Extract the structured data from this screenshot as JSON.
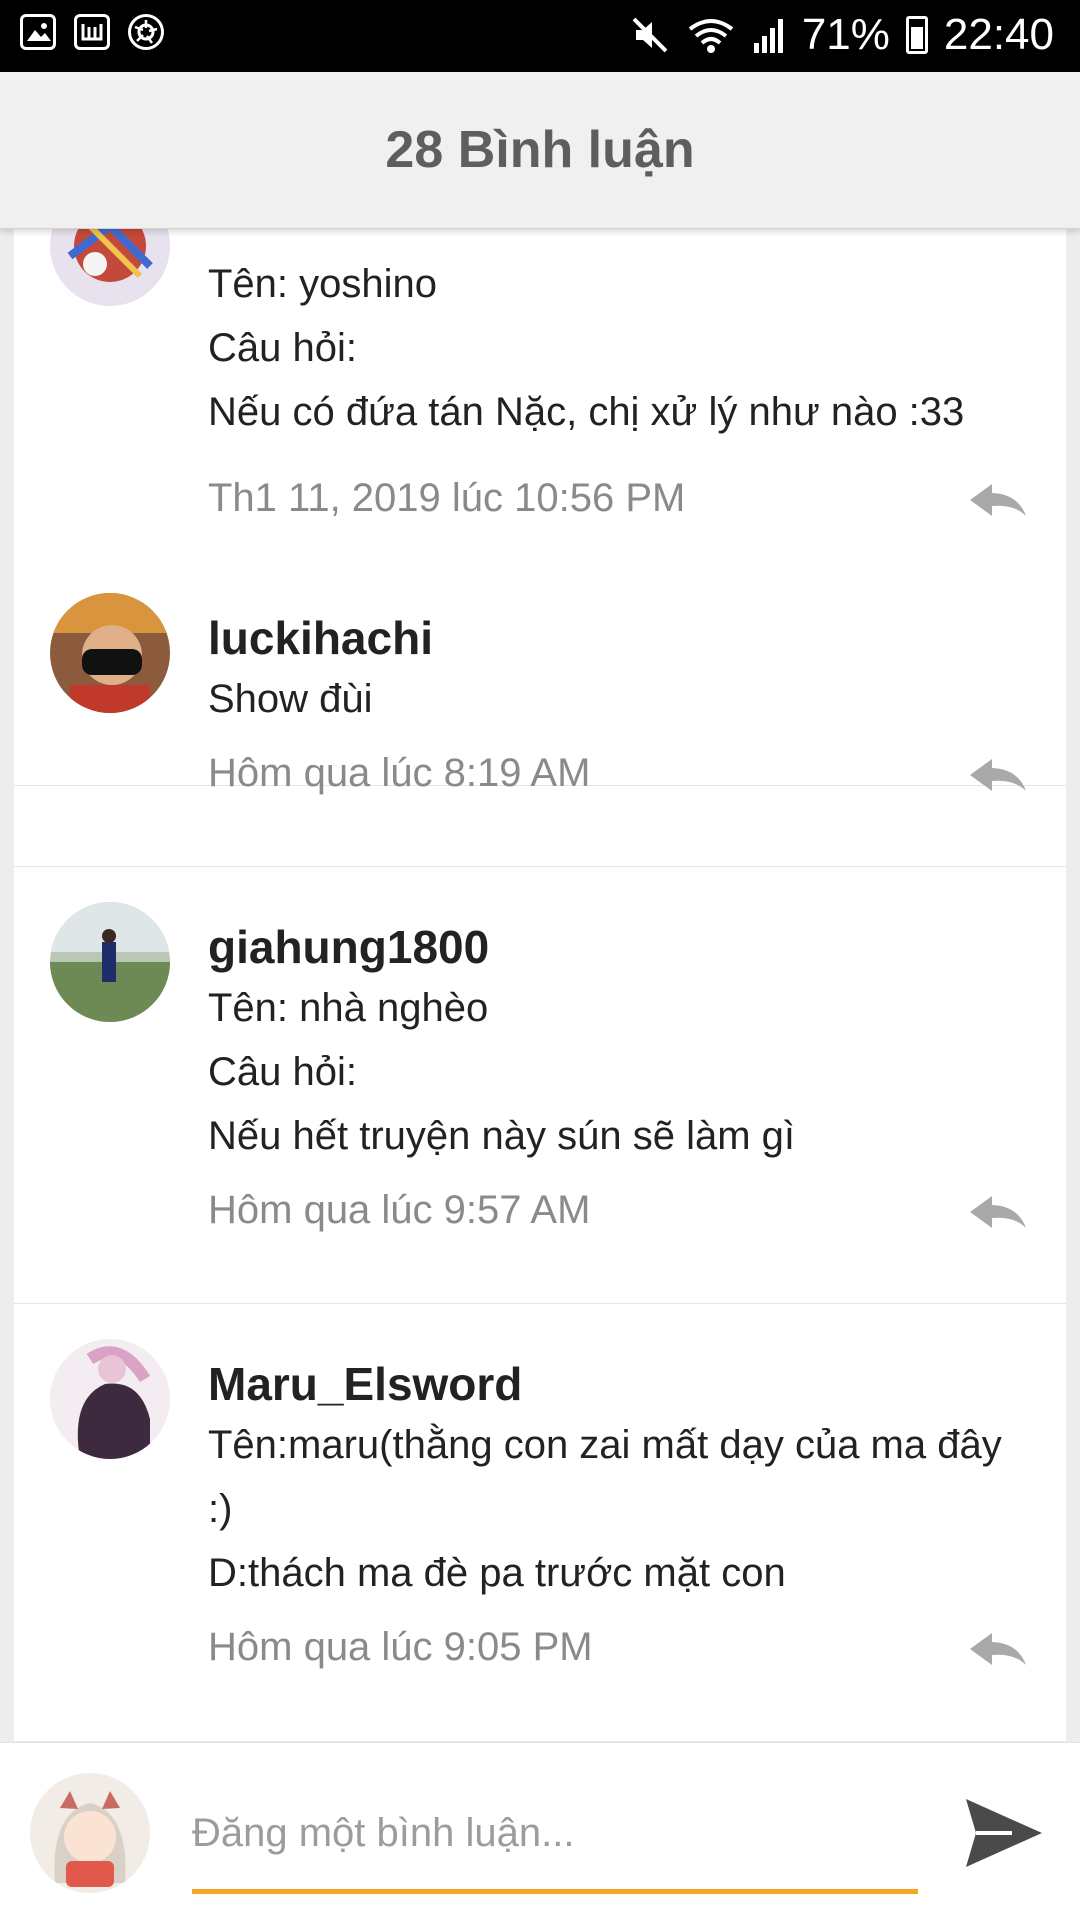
{
  "status_bar": {
    "battery": "71%",
    "time": "22:40",
    "icons": [
      "gallery-icon",
      "app-icon",
      "aperture-icon",
      "mute-icon",
      "wifi-icon",
      "signal-icon",
      "battery-icon"
    ]
  },
  "header": {
    "title": "28 Bình luận"
  },
  "comments": [
    {
      "username": "",
      "lines": [
        "Tên: yoshino",
        "Câu hỏi:",
        "Nếu có đứa tán Nặc, chị xử lý như nào :33"
      ],
      "timestamp": "Th1 11, 2019 lúc 10:56 PM"
    },
    {
      "username": "luckihachi",
      "lines": [
        "Show đùi"
      ],
      "timestamp": "Hôm qua lúc 8:19 AM"
    },
    {
      "username": "giahung1800",
      "lines": [
        "Tên: nhà nghèo",
        "Câu hỏi:",
        "Nếu hết truyện này sún sẽ làm gì"
      ],
      "timestamp": "Hôm qua lúc 9:57 AM"
    },
    {
      "username": "Maru_Elsword",
      "lines": [
        "Tên:maru(thằng con zai mất dạy của ma đây :)",
        "D:thách ma đè pa trước mặt con"
      ],
      "timestamp": "Hôm qua lúc 9:05 PM"
    }
  ],
  "composer": {
    "placeholder": "Đăng một bình luận...",
    "accent_color": "#f5a623"
  },
  "colors": {
    "header_bg": "#f0f0f0",
    "status_bar": "#000000"
  }
}
